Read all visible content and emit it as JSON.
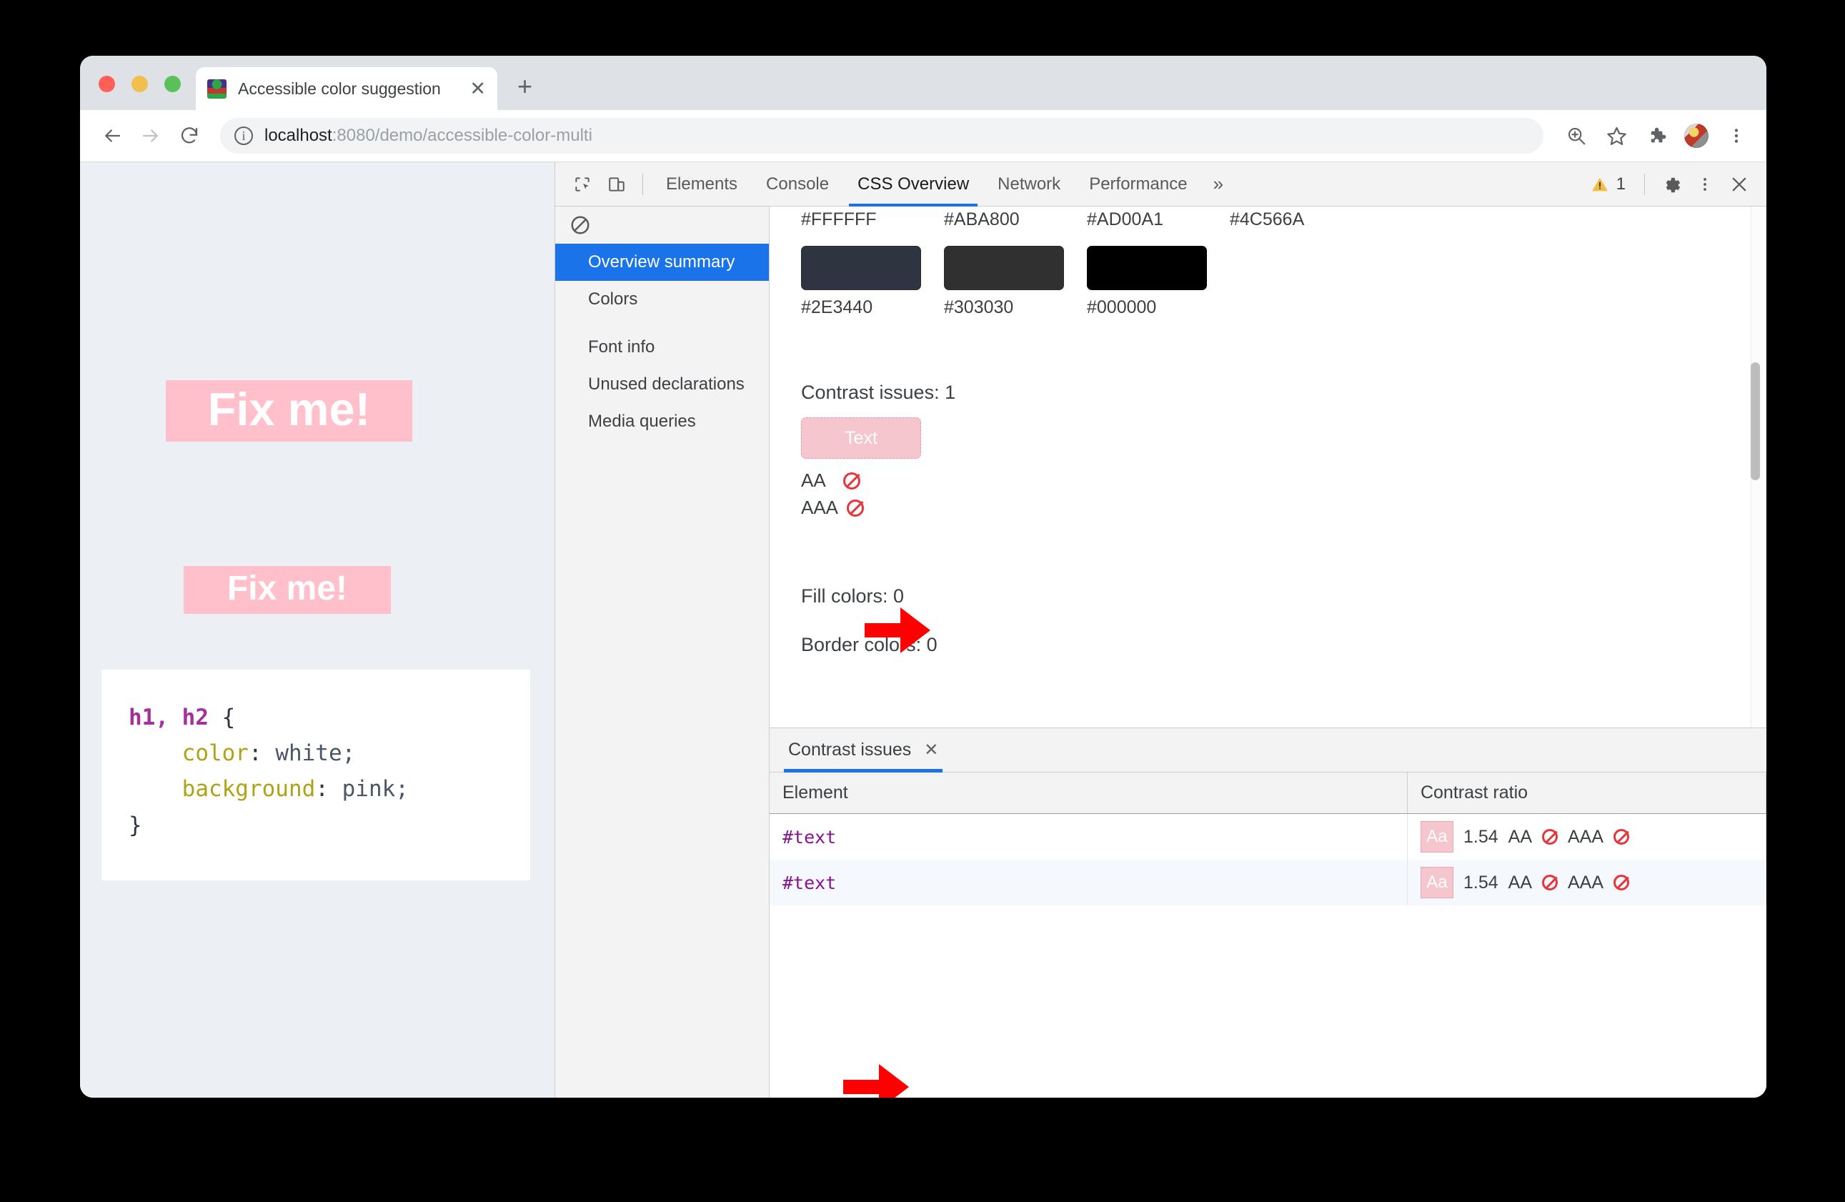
{
  "browser": {
    "tab": {
      "title": "Accessible color suggestion",
      "favicon": "dinosaur-favicon",
      "close_label": "✕"
    },
    "new_tab_label": "+",
    "nav": {
      "back": "←",
      "forward": "→",
      "reload": "↻"
    },
    "omnibox": {
      "site_info": "i",
      "url_host": "localhost",
      "url_path": ":8080/demo/accessible-color-multi"
    },
    "toolbar_icons": [
      "zoom-in-icon",
      "bookmark-star-icon",
      "extensions-puzzle-icon",
      "avatar-icon",
      "browser-menu-icon"
    ]
  },
  "page": {
    "heading1": "Fix me!",
    "heading2": "Fix me!",
    "code": {
      "selectors": "h1, h2",
      "open_brace": " {",
      "prop1": "color",
      "val1": "white;",
      "prop2": "background",
      "val2": "pink;",
      "close_brace": "}",
      "colon": ": "
    },
    "colors": {
      "background": "#ECEFF4",
      "heading_bg": "#FFC0CB",
      "heading_fg": "#FFFFFF"
    }
  },
  "devtools": {
    "toolbar": {
      "inspect_icon": "inspect-element-icon",
      "device_icon": "device-toolbar-icon",
      "tabs": [
        {
          "label": "Elements",
          "active": false
        },
        {
          "label": "Console",
          "active": false
        },
        {
          "label": "CSS Overview",
          "active": false
        },
        {
          "label": "Network",
          "active": false
        },
        {
          "label": "Performance",
          "active": false
        }
      ],
      "more_tabs": "»",
      "warning_count": "1",
      "settings_icon": "gear-icon",
      "menu_icon": "devtools-menu-icon",
      "close_icon": "close-icon"
    },
    "sidebar": {
      "clear_icon": "clear-overview-icon",
      "items": [
        {
          "label": "Overview summary",
          "selected": true
        },
        {
          "label": "Colors",
          "selected": false
        },
        {
          "label": "Font info",
          "selected": false
        },
        {
          "label": "Unused declarations",
          "selected": false
        },
        {
          "label": "Media queries",
          "selected": false
        }
      ]
    },
    "overview": {
      "swatch_row_top": [
        {
          "hex": "#FFFFFF"
        },
        {
          "hex": "#ABA800"
        },
        {
          "hex": "#AD00A1"
        },
        {
          "hex": "#4C566A"
        }
      ],
      "swatch_row_bottom": [
        {
          "hex": "#2E3440"
        },
        {
          "hex": "#303030"
        },
        {
          "hex": "#000000"
        }
      ],
      "contrast_issues_label": "Contrast issues: 1",
      "text_sample": "Text",
      "aa_label": "AA",
      "aaa_label": "AAA",
      "aa_status": "fail",
      "aaa_status": "fail",
      "fill_colors_label": "Fill colors: 0",
      "border_colors_label": "Border colors: 0",
      "text_sample_bg": "#F6C6CF",
      "text_sample_fg": "#FFFFFF"
    },
    "drawer": {
      "tab_label": "Contrast issues",
      "tab_close": "✕",
      "columns": [
        "Element",
        "Contrast ratio"
      ],
      "rows": [
        {
          "element": "#text",
          "swatch_label": "Aa",
          "ratio": "1.54",
          "aa_label": "AA",
          "aa_status": "fail",
          "aaa_label": "AAA",
          "aaa_status": "fail"
        },
        {
          "element": "#text",
          "swatch_label": "Aa",
          "ratio": "1.54",
          "aa_label": "AA",
          "aa_status": "fail",
          "aaa_label": "AAA",
          "aaa_status": "fail"
        }
      ]
    }
  },
  "annotations": {
    "arrows": [
      {
        "name": "arrow-pointing-to-text-sample",
        "color": "#FF0000"
      },
      {
        "name": "arrow-pointing-to-issues-table",
        "color": "#FF0000"
      }
    ]
  }
}
